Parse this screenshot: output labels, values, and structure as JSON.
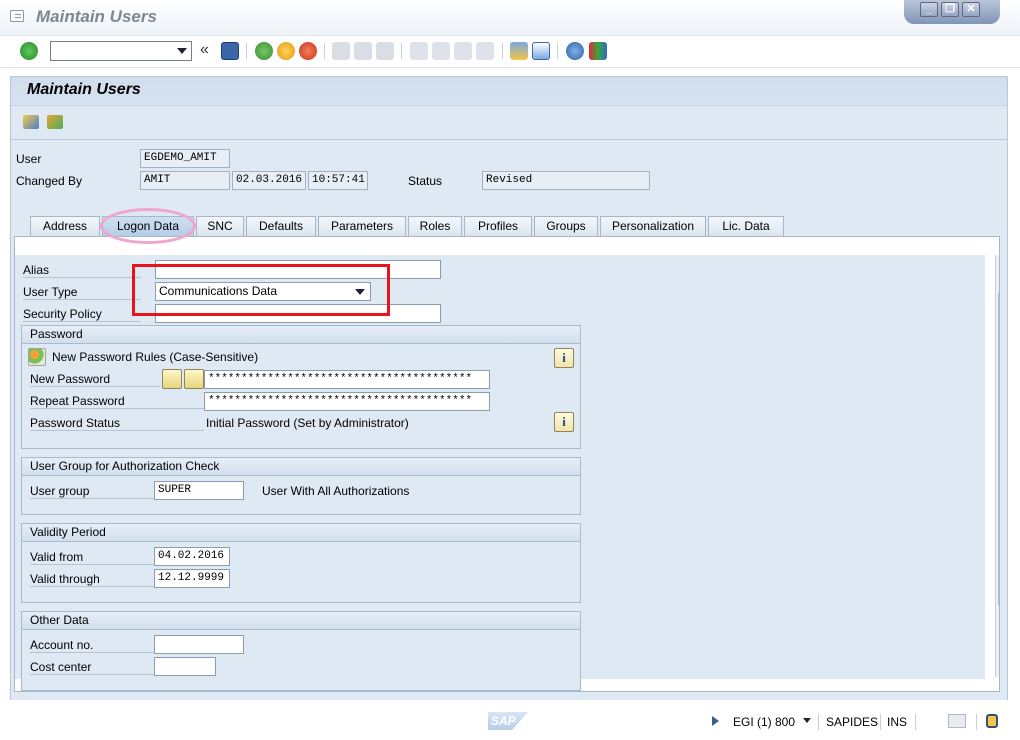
{
  "window": {
    "title": "Maintain Users",
    "controls": [
      "minimize",
      "restore",
      "close"
    ]
  },
  "toolbar": {
    "command_field": {
      "value": "",
      "placeholder": ""
    },
    "icons": [
      "enter-icon",
      "back-double-icon",
      "save-icon",
      "back-icon",
      "exit-icon",
      "cancel-icon",
      "print-icon",
      "find-icon",
      "find-next-icon",
      "first-page-icon",
      "previous-page-icon",
      "next-page-icon",
      "last-page-icon",
      "create-session-icon",
      "shortcut-icon",
      "help-icon",
      "customize-layout-icon"
    ]
  },
  "screen": {
    "title": "Maintain Users"
  },
  "header_fields": {
    "user_label": "User",
    "user_value": "EGDEMO_AMIT",
    "changed_by_label": "Changed By",
    "changed_by_value": "AMIT",
    "changed_date": "02.03.2016",
    "changed_time": "10:57:41",
    "status_label": "Status",
    "status_value": "Revised"
  },
  "tabs": [
    {
      "label": "Address"
    },
    {
      "label": "Logon Data",
      "active": true
    },
    {
      "label": "SNC"
    },
    {
      "label": "Defaults"
    },
    {
      "label": "Parameters"
    },
    {
      "label": "Roles"
    },
    {
      "label": "Profiles"
    },
    {
      "label": "Groups"
    },
    {
      "label": "Personalization"
    },
    {
      "label": "Lic. Data"
    }
  ],
  "logon": {
    "alias_label": "Alias",
    "alias_value": "",
    "user_type_label": "User Type",
    "user_type_value": "Communications Data",
    "security_policy_label": "Security Policy",
    "security_policy_value": ""
  },
  "password": {
    "group_title": "Password",
    "rules_text": "New Password Rules (Case-Sensitive)",
    "new_label": "New Password",
    "new_value": "****************************************",
    "repeat_label": "Repeat Password",
    "repeat_value": "****************************************",
    "status_label": "Password Status",
    "status_value": "Initial Password (Set by Administrator)"
  },
  "user_group": {
    "group_title": "User Group for Authorization Check",
    "label": "User group",
    "value": "SUPER",
    "description": "User With All Authorizations"
  },
  "validity": {
    "group_title": "Validity Period",
    "from_label": "Valid from",
    "from_value": "04.02.2016",
    "through_label": "Valid through",
    "through_value": "12.12.9999"
  },
  "other": {
    "group_title": "Other Data",
    "account_label": "Account no.",
    "account_value": "",
    "cost_center_label": "Cost center",
    "cost_center_value": ""
  },
  "statusbar": {
    "logo_text": "SAP",
    "system": "EGI (1) 800",
    "server": "SAPIDES",
    "mode": "INS"
  },
  "colors": {
    "highlight_box": "#e8141c",
    "highlight_circle": "#f0a6cc",
    "panel_background": "#dfe9f3"
  }
}
